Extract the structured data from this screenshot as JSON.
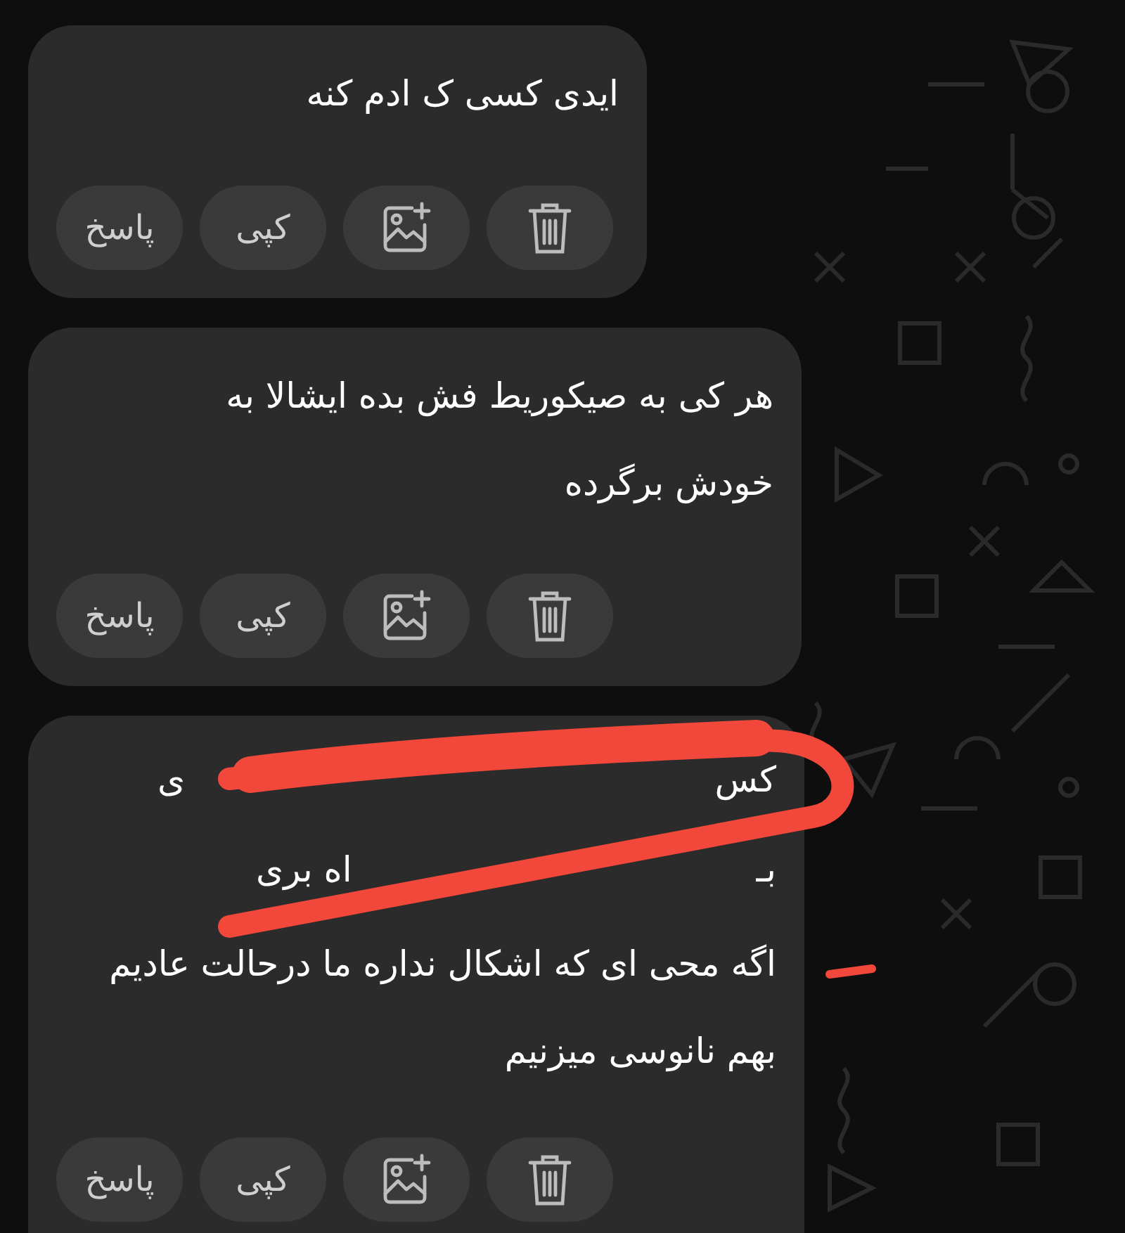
{
  "messages": [
    {
      "lines": [
        {
          "kind": "text",
          "text": "ایدی کسی ک ادم کنه"
        }
      ],
      "actions": [
        {
          "kind": "delete"
        },
        {
          "kind": "add-image"
        },
        {
          "kind": "copy",
          "label": "کپی"
        },
        {
          "kind": "reply",
          "label": "پاسخ"
        }
      ]
    },
    {
      "lines": [
        {
          "kind": "text",
          "text": "هر کی به صیکوریط فش بده ایشالا به"
        },
        {
          "kind": "text",
          "text": "خودش برگرده"
        }
      ],
      "actions": [
        {
          "kind": "delete"
        },
        {
          "kind": "add-image"
        },
        {
          "kind": "copy",
          "label": "کپی"
        },
        {
          "kind": "reply",
          "label": "پاسخ"
        }
      ]
    },
    {
      "lines": [
        {
          "kind": "redacted",
          "start": "کس",
          "end": "ی"
        },
        {
          "kind": "redacted",
          "start": "بـ",
          "end": "اه بری"
        },
        {
          "kind": "text",
          "text": "اگه محی ای که اشکال نداره ما درحالت عادیم"
        },
        {
          "kind": "text",
          "text": "بهم نانوسی میزنیم"
        }
      ],
      "actions": [
        {
          "kind": "delete"
        },
        {
          "kind": "add-image"
        },
        {
          "kind": "copy",
          "label": "کپی"
        },
        {
          "kind": "reply",
          "label": "پاسخ"
        }
      ]
    }
  ]
}
